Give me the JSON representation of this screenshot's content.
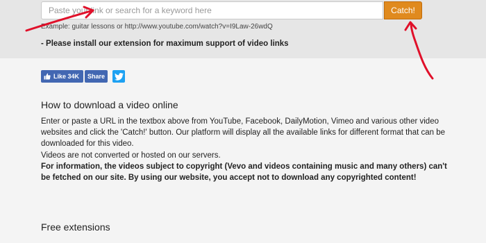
{
  "search": {
    "placeholder": "Paste your link or search for a keyword here",
    "button_label": "Catch!",
    "example": "Example: guitar lessons or http://www.youtube.com/watch?v=I9Law-26wdQ"
  },
  "notice": "- Please install our extension for maximum support of video links",
  "social": {
    "like_label": "Like 34K",
    "share_label": "Share",
    "twitter_icon": "twitter-bird-icon"
  },
  "howto": {
    "title": "How to download a video online",
    "line1": "Enter or paste a URL in the textbox above from YouTube, Facebook, DailyMotion, Vimeo and various other video websites and click the 'Catch!' button. Our platform will display all the available links for different format that can be downloaded for this video.",
    "line2": "Videos are not converted or hosted on our servers.",
    "warning": "For information, the videos subject to copyright (Vevo and videos containing music and many others) can't be fetched on our site. By using our website, you accept not to download any copyrighted content!"
  },
  "extensions": {
    "title": "Free extensions"
  },
  "colors": {
    "catch_button": "#e08a1e",
    "facebook": "#4267b2",
    "twitter": "#1da1f2",
    "annotation_arrows": "#e0102a"
  }
}
